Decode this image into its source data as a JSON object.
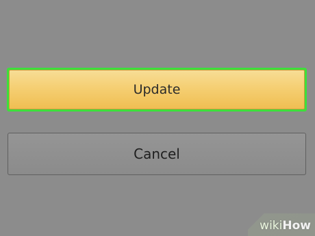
{
  "dialog": {
    "update_label": "Update",
    "cancel_label": "Cancel"
  },
  "watermark": {
    "wiki": "wiki",
    "how": "How"
  },
  "colors": {
    "background": "#8c8c8c",
    "highlight": "#3de03a",
    "primary_button": "#f5cf73",
    "secondary_button": "#8e8e8e"
  }
}
